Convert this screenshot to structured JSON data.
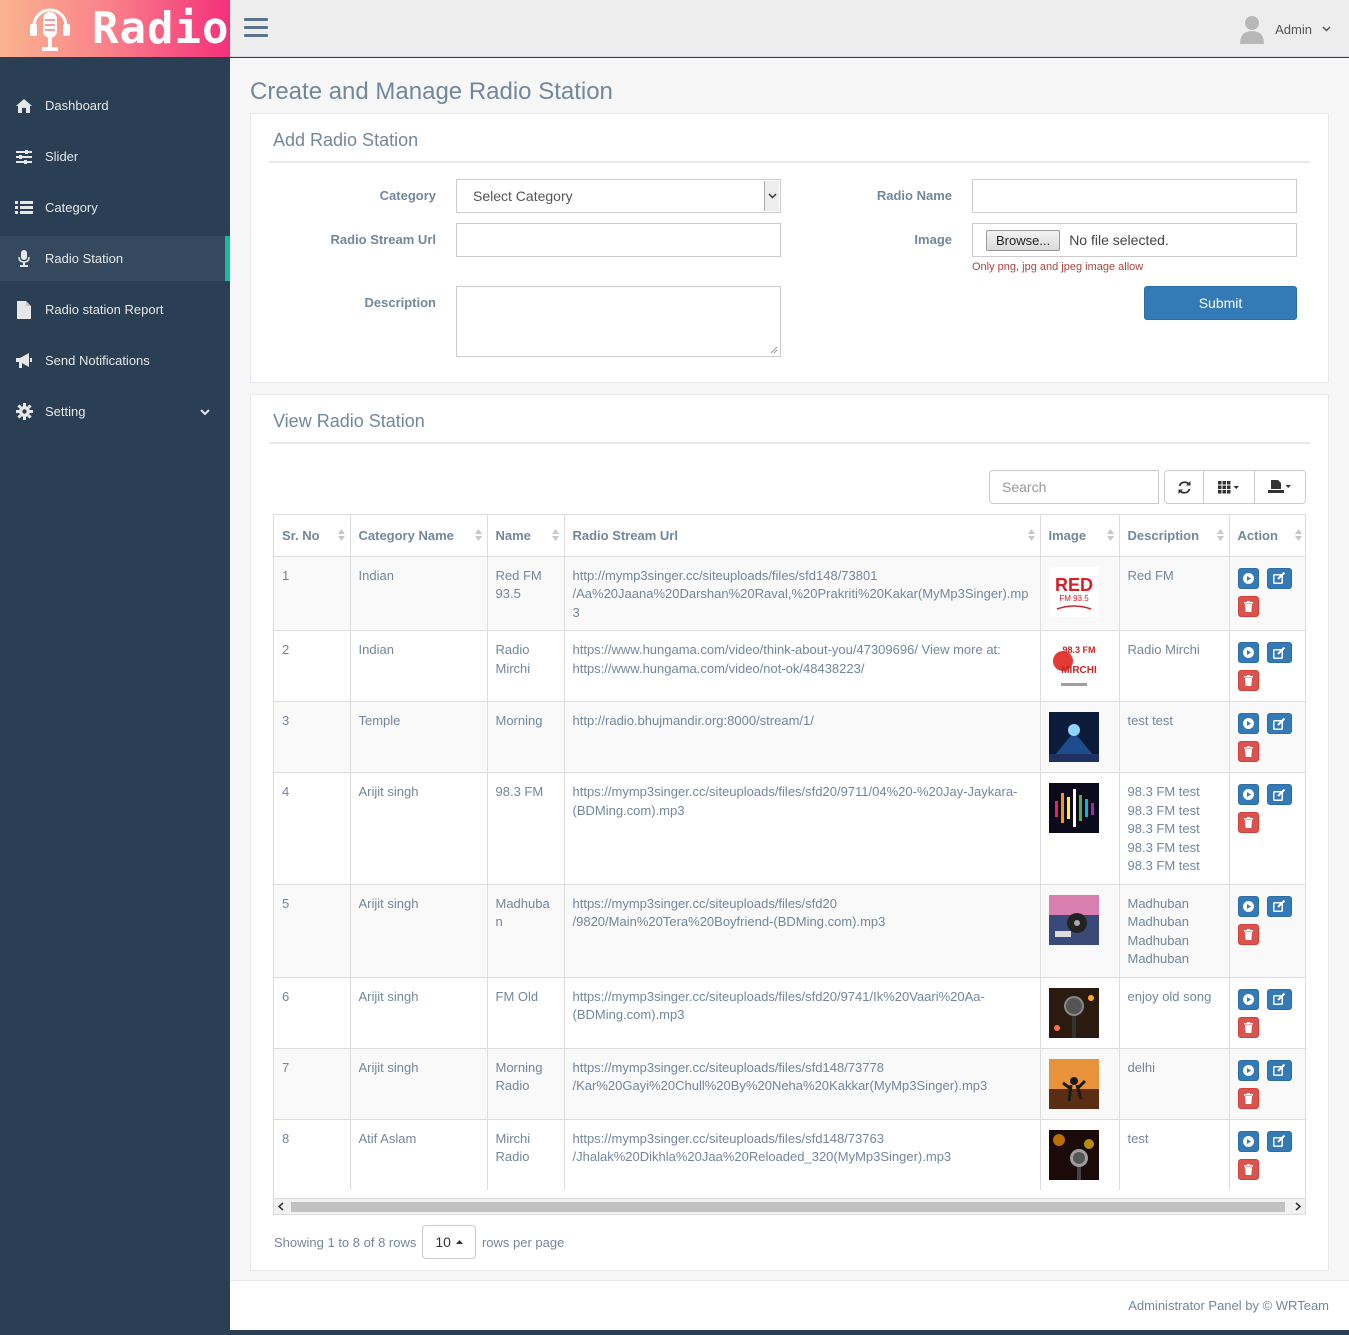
{
  "app": {
    "logo_text": "Radio"
  },
  "sidebar": {
    "items": [
      {
        "label": "Dashboard",
        "icon": "home-icon"
      },
      {
        "label": "Slider",
        "icon": "sliders-icon"
      },
      {
        "label": "Category",
        "icon": "list-icon"
      },
      {
        "label": "Radio Station",
        "icon": "microphone-icon",
        "active": true
      },
      {
        "label": "Radio station Report",
        "icon": "file-icon"
      },
      {
        "label": "Send Notifications",
        "icon": "bullhorn-icon"
      },
      {
        "label": "Setting",
        "icon": "gear-icon"
      }
    ]
  },
  "topbar": {
    "user_name": "Admin"
  },
  "page": {
    "title": "Create and Manage Radio Station"
  },
  "add_form": {
    "title": "Add Radio Station",
    "category_label": "Category",
    "category_value": "Select Category",
    "radio_name_label": "Radio Name",
    "radio_name_value": "",
    "stream_url_label": "Radio Stream Url",
    "stream_url_value": "",
    "image_label": "Image",
    "browse_label": "Browse...",
    "file_status": "No file selected.",
    "image_hint": "Only png, jpg and jpeg image allow",
    "description_label": "Description",
    "description_value": "",
    "submit_label": "Submit"
  },
  "view_table": {
    "title": "View Radio Station",
    "search_placeholder": "Search",
    "columns": [
      "Sr. No",
      "Category Name",
      "Name",
      "Radio Stream Url",
      "Image",
      "Description",
      "Action"
    ],
    "rows": [
      {
        "sr": "1",
        "category": "Indian",
        "name": "Red FM 93.5",
        "url": "http://mymp3singer.cc/siteuploads/files/sfd148/73801 /Aa%20Jaana%20Darshan%20Raval,%20Prakriti%20Kakar(MyMp3Singer).mp3",
        "description": "Red FM"
      },
      {
        "sr": "2",
        "category": "Indian",
        "name": "Radio Mirchi",
        "url": "https://www.hungama.com/video/think-about-you/47309696/ View more at: https://www.hungama.com/video/not-ok/48438223/",
        "description": "Radio Mirchi"
      },
      {
        "sr": "3",
        "category": "Temple",
        "name": "Morning",
        "url": "http://radio.bhujmandir.org:8000/stream/1/",
        "description": "test test"
      },
      {
        "sr": "4",
        "category": "Arijit singh",
        "name": "98.3 FM",
        "url": "https://mymp3singer.cc/siteuploads/files/sfd20/9711/04%20-%20Jay-Jaykara-(BDMing.com).mp3",
        "description": "98.3 FM test 98.3 FM test 98.3 FM test 98.3 FM test 98.3 FM test"
      },
      {
        "sr": "5",
        "category": "Arijit singh",
        "name": "Madhuban",
        "url": "https://mymp3singer.cc/siteuploads/files/sfd20 /9820/Main%20Tera%20Boyfriend-(BDMing.com).mp3",
        "description": "Madhuban Madhuban Madhuban Madhuban"
      },
      {
        "sr": "6",
        "category": "Arijit singh",
        "name": "FM Old",
        "url": "https://mymp3singer.cc/siteuploads/files/sfd20/9741/Ik%20Vaari%20Aa-(BDMing.com).mp3",
        "description": "enjoy old song"
      },
      {
        "sr": "7",
        "category": "Arijit singh",
        "name": "Morning Radio",
        "url": "https://mymp3singer.cc/siteuploads/files/sfd148/73778 /Kar%20Gayi%20Chull%20By%20Neha%20Kakkar(MyMp3Singer).mp3",
        "description": "delhi"
      },
      {
        "sr": "8",
        "category": "Atif Aslam",
        "name": "Mirchi Radio",
        "url": "https://mymp3singer.cc/siteuploads/files/sfd148/73763 /Jhalak%20Dikhla%20Jaa%20Reloaded_320(MyMp3Singer).mp3",
        "description": "test"
      }
    ],
    "showing_text": "Showing 1 to 8 of 8 rows",
    "page_size": "10",
    "rows_per_page_text": "rows per page"
  },
  "footer": {
    "text": "Administrator Panel by © WRTeam"
  },
  "colors": {
    "sidebar_bg": "#2a3f54",
    "accent": "#1abb9c",
    "primary": "#337ab7",
    "danger": "#d9534f"
  }
}
